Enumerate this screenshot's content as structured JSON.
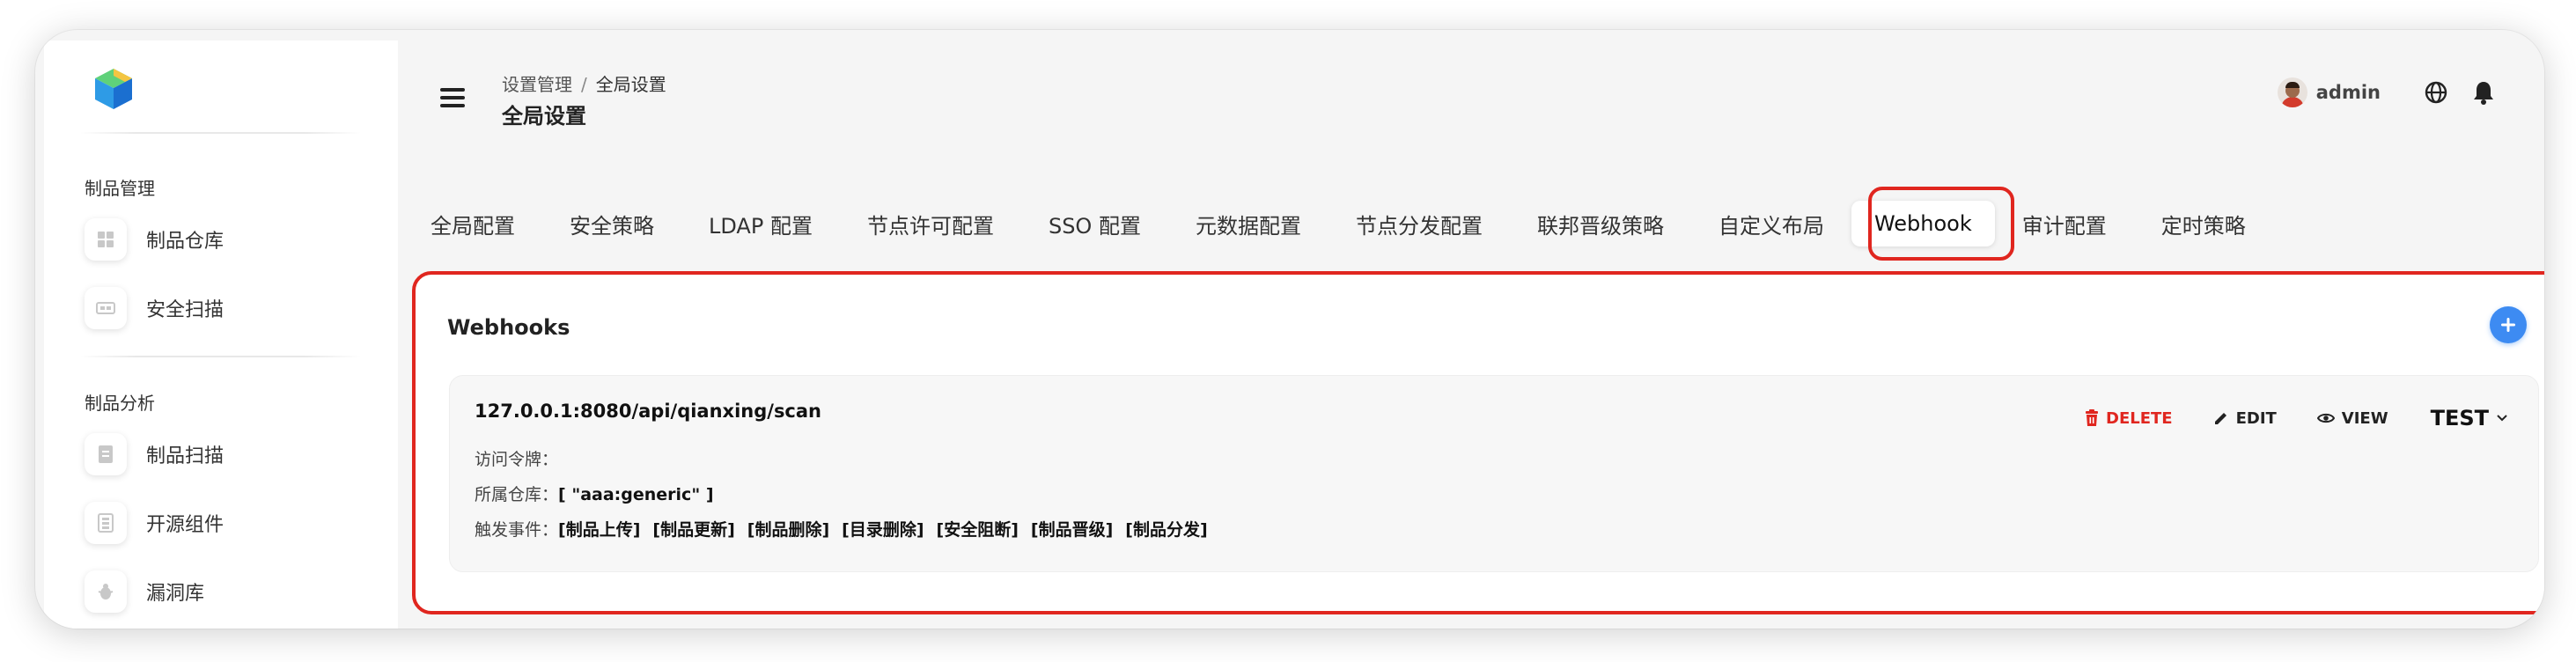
{
  "sidebar": {
    "groups": [
      {
        "title": "制品管理",
        "items": [
          {
            "label": "制品仓库",
            "icon": "grid-icon"
          },
          {
            "label": "安全扫描",
            "icon": "scan-icon"
          }
        ]
      },
      {
        "title": "制品分析",
        "items": [
          {
            "label": "制品扫描",
            "icon": "document-scan-icon"
          },
          {
            "label": "开源组件",
            "icon": "components-icon"
          },
          {
            "label": "漏洞库",
            "icon": "bug-icon"
          }
        ]
      }
    ]
  },
  "header": {
    "breadcrumb": {
      "parent": "设置管理",
      "separator": "/",
      "current": "全局设置"
    },
    "title": "全局设置",
    "user": {
      "name": "admin"
    }
  },
  "tabs": [
    {
      "label": "全局配置",
      "active": false
    },
    {
      "label": "安全策略",
      "active": false
    },
    {
      "label": "LDAP 配置",
      "active": false
    },
    {
      "label": "节点许可配置",
      "active": false
    },
    {
      "label": "SSO 配置",
      "active": false
    },
    {
      "label": "元数据配置",
      "active": false
    },
    {
      "label": "节点分发配置",
      "active": false
    },
    {
      "label": "联邦晋级策略",
      "active": false
    },
    {
      "label": "自定义布局",
      "active": false
    },
    {
      "label": "Webhook",
      "active": true
    },
    {
      "label": "审计配置",
      "active": false
    },
    {
      "label": "定时策略",
      "active": false
    }
  ],
  "webhooks": {
    "title": "Webhooks",
    "items": [
      {
        "url": "127.0.0.1:8080/api/qianxing/scan",
        "token_label": "访问令牌：",
        "token_value": "",
        "repo_label": "所属仓库：",
        "repo_value": "[ \"aaa:generic\" ]",
        "events_label": "触发事件：",
        "events": [
          "[制品上传]",
          "[制品更新]",
          "[制品删除]",
          "[目录删除]",
          "[安全阻断]",
          "[制品晋级]",
          "[制品分发]"
        ],
        "actions": {
          "delete": "DELETE",
          "edit": "EDIT",
          "view": "VIEW",
          "test": "TEST"
        }
      }
    ]
  },
  "colors": {
    "accent": "#3d8bf2",
    "danger": "#e0261f",
    "highlight": "#e0261f"
  }
}
